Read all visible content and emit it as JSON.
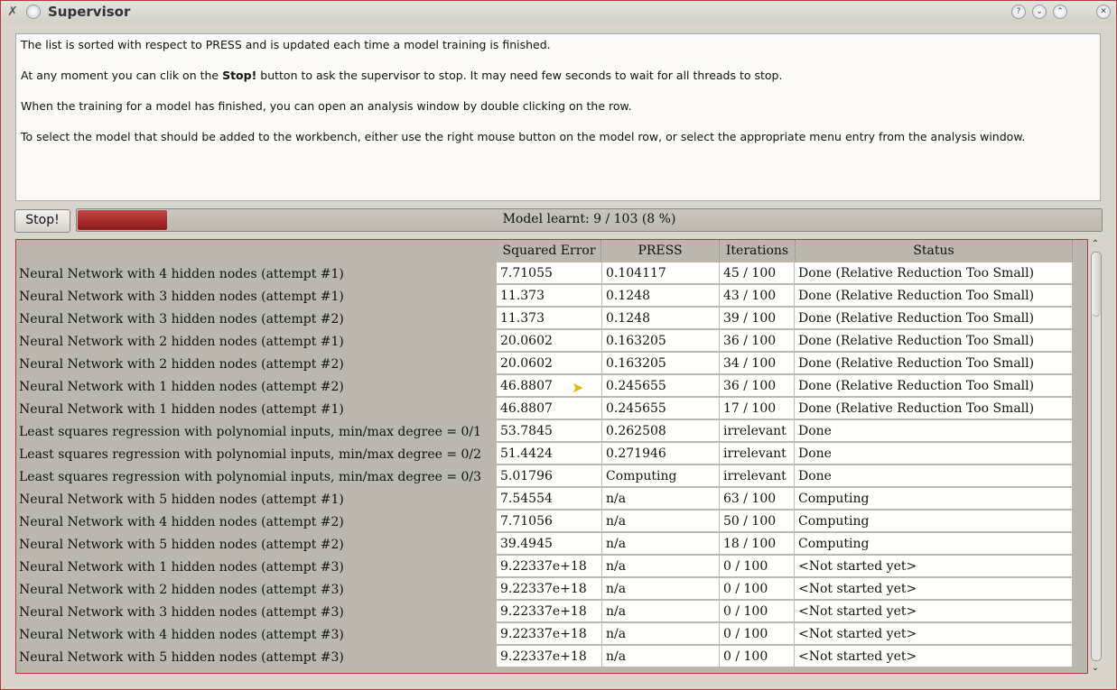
{
  "window": {
    "title": "Supervisor",
    "buttons": [
      "?",
      "⌄",
      "⌃",
      "✕"
    ]
  },
  "info": {
    "line1": "The list is sorted with respect to PRESS and is updated each time a model training is finished.",
    "line2_pre": "At any moment you can clik on the ",
    "line2_bold": "Stop!",
    "line2_post": " button to ask the supervisor to stop. It may need few seconds to wait for all threads to stop.",
    "line3": "When the training for a model has finished, you can open an analysis window by double clicking on the row.",
    "line4": "To select the model that should be added to the workbench, either use the right mouse button on the model row, or select the appropriate menu entry from the analysis window."
  },
  "controls": {
    "stop_label": "Stop!",
    "progress_text": "Model learnt: 9 /  103 (8 %)",
    "progress_fraction": 0.087
  },
  "table": {
    "headers": [
      "Squared Error",
      "PRESS",
      "Iterations",
      "Status"
    ],
    "rows": [
      {
        "name": "Neural Network with 4 hidden nodes (attempt #1)",
        "se": "7.71055",
        "press": "0.104117",
        "iter": "45 /  100",
        "status": "Done (Relative Reduction Too Small)"
      },
      {
        "name": "Neural Network with 3 hidden nodes (attempt #1)",
        "se": "11.373",
        "press": "0.1248",
        "iter": "43 /  100",
        "status": "Done (Relative Reduction Too Small)"
      },
      {
        "name": "Neural Network with 3 hidden nodes (attempt #2)",
        "se": "11.373",
        "press": "0.1248",
        "iter": "39 /  100",
        "status": "Done (Relative Reduction Too Small)"
      },
      {
        "name": "Neural Network with 2 hidden nodes (attempt #1)",
        "se": "20.0602",
        "press": "0.163205",
        "iter": "36 /  100",
        "status": "Done (Relative Reduction Too Small)"
      },
      {
        "name": "Neural Network with 2 hidden nodes (attempt #2)",
        "se": "20.0602",
        "press": "0.163205",
        "iter": "34 /  100",
        "status": "Done (Relative Reduction Too Small)"
      },
      {
        "name": "Neural Network with 1 hidden nodes (attempt #2)",
        "se": "46.8807",
        "press": "0.245655",
        "iter": "36 /  100",
        "status": "Done (Relative Reduction Too Small)"
      },
      {
        "name": "Neural Network with 1 hidden nodes (attempt #1)",
        "se": "46.8807",
        "press": "0.245655",
        "iter": "17 /  100",
        "status": "Done (Relative Reduction Too Small)"
      },
      {
        "name": "Least squares regression with polynomial inputs, min/max degree = 0/1",
        "se": "53.7845",
        "press": "0.262508",
        "iter": "irrelevant",
        "status": "Done"
      },
      {
        "name": "Least squares regression with polynomial inputs, min/max degree = 0/2",
        "se": "51.4424",
        "press": "0.271946",
        "iter": "irrelevant",
        "status": "Done"
      },
      {
        "name": "Least squares regression with polynomial inputs, min/max degree = 0/3",
        "se": "5.01796",
        "press": "Computing",
        "iter": "irrelevant",
        "status": "Done"
      },
      {
        "name": "Neural Network with 5 hidden nodes (attempt #1)",
        "se": "7.54554",
        "press": "n/a",
        "iter": "63 /  100",
        "status": "Computing"
      },
      {
        "name": "Neural Network with 4 hidden nodes (attempt #2)",
        "se": "7.71056",
        "press": "n/a",
        "iter": "50 /  100",
        "status": "Computing"
      },
      {
        "name": "Neural Network with 5 hidden nodes (attempt #2)",
        "se": "39.4945",
        "press": "n/a",
        "iter": "18 /  100",
        "status": "Computing"
      },
      {
        "name": "Neural Network with 1 hidden nodes (attempt #3)",
        "se": "9.22337e+18",
        "press": "n/a",
        "iter": "0 /  100",
        "status": "<Not started yet>"
      },
      {
        "name": "Neural Network with 2 hidden nodes (attempt #3)",
        "se": "9.22337e+18",
        "press": "n/a",
        "iter": "0 /  100",
        "status": "<Not started yet>"
      },
      {
        "name": "Neural Network with 3 hidden nodes (attempt #3)",
        "se": "9.22337e+18",
        "press": "n/a",
        "iter": "0 /  100",
        "status": "<Not started yet>"
      },
      {
        "name": "Neural Network with 4 hidden nodes (attempt #3)",
        "se": "9.22337e+18",
        "press": "n/a",
        "iter": "0 /  100",
        "status": "<Not started yet>"
      },
      {
        "name": "Neural Network with 5 hidden nodes (attempt #3)",
        "se": "9.22337e+18",
        "press": "n/a",
        "iter": "0 /  100",
        "status": "<Not started yet>"
      }
    ]
  }
}
